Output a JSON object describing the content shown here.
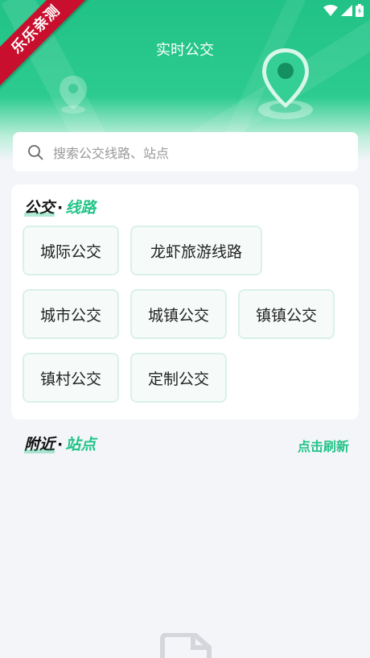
{
  "header": {
    "title": "实时公交",
    "watermark": "乐乐亲测"
  },
  "search": {
    "placeholder": "搜索公交线路、站点"
  },
  "routes": {
    "title_main": "公交",
    "title_sep": "·",
    "title_accent": "线路",
    "items": [
      {
        "label": "城际公交"
      },
      {
        "label": "龙虾旅游线路"
      },
      {
        "label": "城市公交"
      },
      {
        "label": "城镇公交"
      },
      {
        "label": "镇镇公交"
      },
      {
        "label": "镇村公交"
      },
      {
        "label": "定制公交"
      }
    ]
  },
  "nearby": {
    "title_main": "附近",
    "title_sep": "·",
    "title_accent": "站点",
    "refresh_label": "点击刷新"
  },
  "colors": {
    "accent": "#22c488",
    "header_green": "#21c287",
    "ribbon_red": "#c8102e"
  }
}
